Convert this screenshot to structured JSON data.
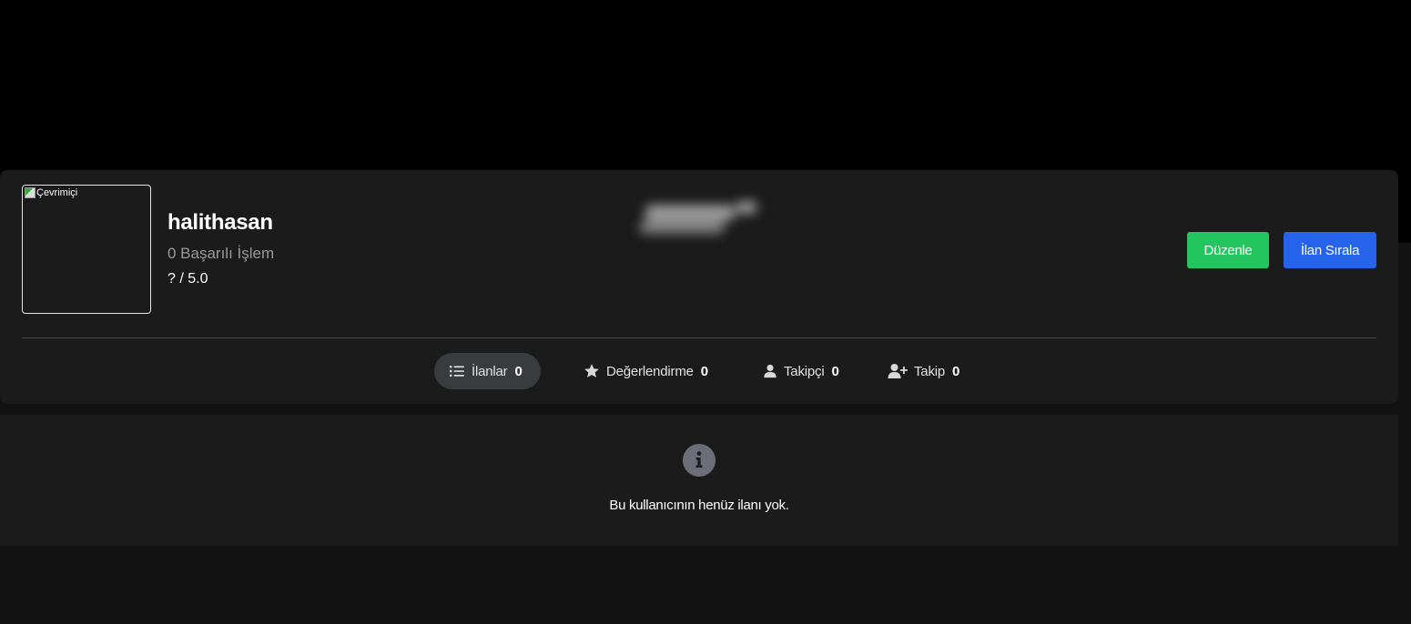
{
  "profile": {
    "avatar_alt": "Çevrimiçi",
    "username": "halithasan",
    "success_count": "0 Başarılı İşlem",
    "rating": "? / 5.0"
  },
  "actions": {
    "edit_label": "Düzenle",
    "sort_label": "İlan Sırala"
  },
  "tabs": [
    {
      "label": "İlanlar",
      "count": "0",
      "icon": "list-icon",
      "active": true
    },
    {
      "label": "Değerlendirme",
      "count": "0",
      "icon": "star-icon",
      "active": false
    },
    {
      "label": "Takipçi",
      "count": "0",
      "icon": "user-icon",
      "active": false
    },
    {
      "label": "Takip",
      "count": "0",
      "icon": "user-plus-icon",
      "active": false
    }
  ],
  "empty_state": {
    "icon": "info-icon",
    "message": "Bu kullanıcının henüz ilanı yok."
  },
  "colors": {
    "edit_button": "#22c55e",
    "sort_button": "#2563eb",
    "active_tab": "#3a3b3f",
    "card_background": "#1b1b1b"
  }
}
